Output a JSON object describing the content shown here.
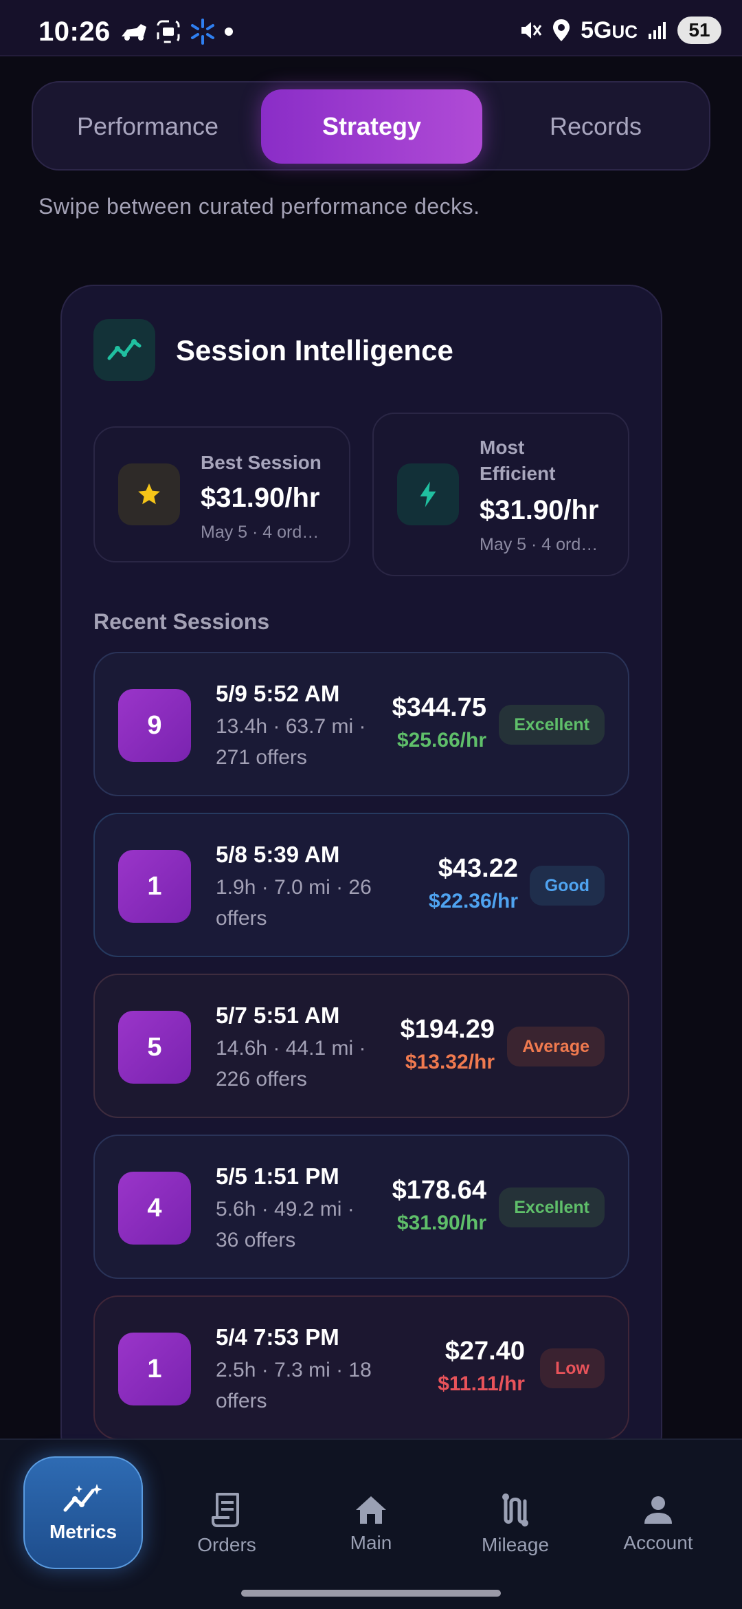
{
  "status_bar": {
    "time": "10:26",
    "network": "5G",
    "network_suffix": "UC",
    "battery": "51"
  },
  "tabs": [
    {
      "label": "Performance",
      "active": false
    },
    {
      "label": "Strategy",
      "active": true
    },
    {
      "label": "Records",
      "active": false
    }
  ],
  "tagline": "Swipe between curated performance decks.",
  "card": {
    "title": "Session Intelligence",
    "icon": "trend-line-icon",
    "best": {
      "label": "Best Session",
      "value": "$31.90/hr",
      "sub": "May 5 · 4 ord…",
      "icon": "star-icon"
    },
    "efficient": {
      "label_line1": "Most",
      "label_line2": "Efficient",
      "value": "$31.90/hr",
      "sub": "May 5 · 4 ord…",
      "icon": "lightning-icon"
    },
    "recent_label": "Recent Sessions"
  },
  "sessions": [
    {
      "count": "9",
      "date": "5/9 5:52 AM",
      "meta_line1": "13.4h · 63.7 mi ·",
      "meta_line2": "271 offers",
      "amount": "$344.75",
      "rate": "$25.66/hr",
      "rating": "Excellent"
    },
    {
      "count": "1",
      "date": "5/8 5:39 AM",
      "meta_line1": "1.9h · 7.0 mi · 26",
      "meta_line2": "offers",
      "amount": "$43.22",
      "rate": "$22.36/hr",
      "rating": "Good"
    },
    {
      "count": "5",
      "date": "5/7 5:51 AM",
      "meta_line1": "14.6h · 44.1 mi ·",
      "meta_line2": "226 offers",
      "amount": "$194.29",
      "rate": "$13.32/hr",
      "rating": "Average"
    },
    {
      "count": "4",
      "date": "5/5 1:51 PM",
      "meta_line1": "5.6h · 49.2 mi ·",
      "meta_line2": "36 offers",
      "amount": "$178.64",
      "rate": "$31.90/hr",
      "rating": "Excellent"
    },
    {
      "count": "1",
      "date": "5/4 7:53 PM",
      "meta_line1": "2.5h · 7.3 mi · 18",
      "meta_line2": "offers",
      "amount": "$27.40",
      "rate": "$11.11/hr",
      "rating": "Low"
    }
  ],
  "colors": {
    "excellent": "#5fbf6a",
    "good": "#4fa3f0",
    "average": "#f07a4f",
    "low": "#e8535a",
    "accent": "#a540d1"
  },
  "nav": [
    {
      "label": "Metrics",
      "icon": "sparkle-chart-icon",
      "active": true
    },
    {
      "label": "Orders",
      "icon": "receipt-icon",
      "active": false
    },
    {
      "label": "Main",
      "icon": "home-icon",
      "active": false
    },
    {
      "label": "Mileage",
      "icon": "route-icon",
      "active": false
    },
    {
      "label": "Account",
      "icon": "person-icon",
      "active": false
    }
  ]
}
